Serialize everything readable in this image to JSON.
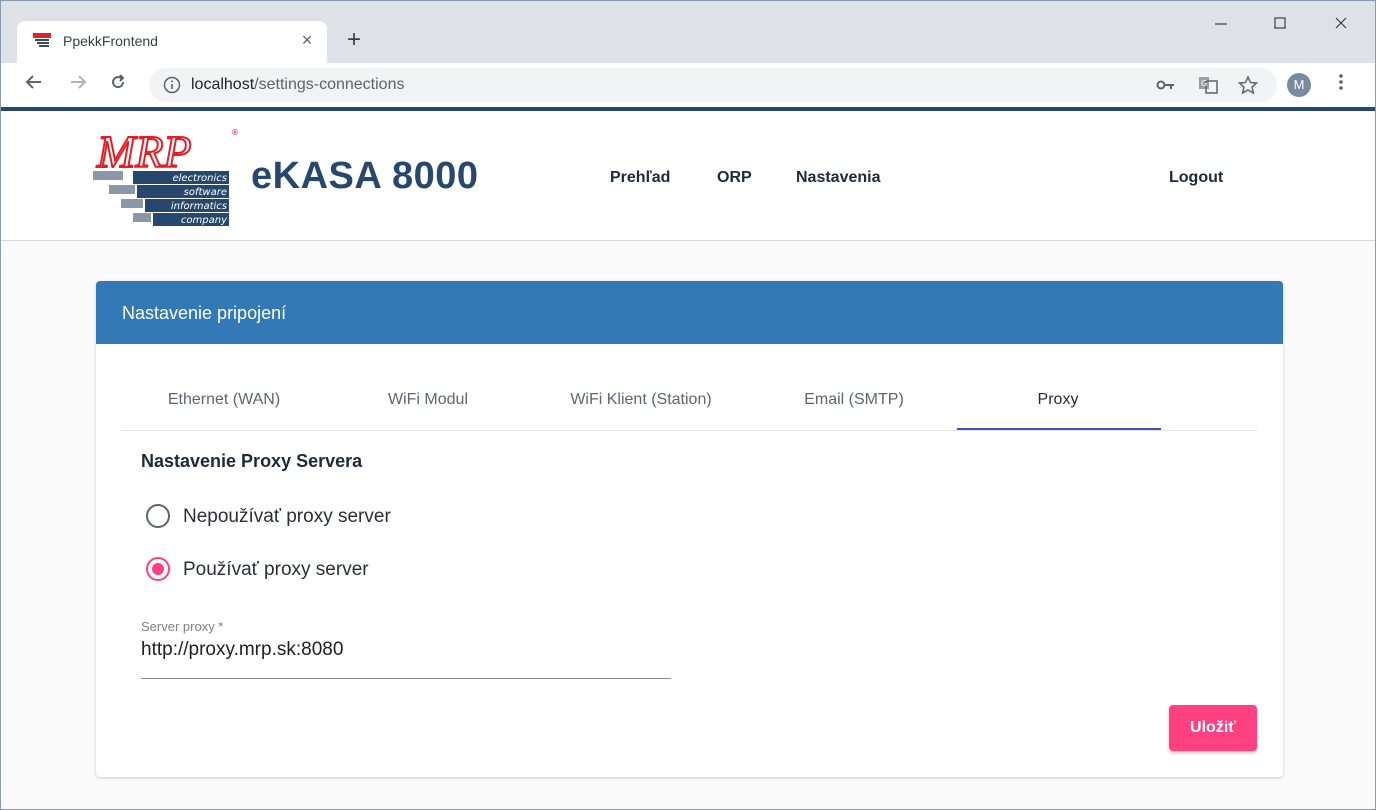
{
  "browser": {
    "tab_title": "PpekkFrontend",
    "new_tab_label": "+",
    "url_host": "localhost",
    "url_path": "/settings-connections",
    "avatar_letter": "M",
    "icons": {
      "back": "arrow-left",
      "forward": "arrow-right",
      "reload": "reload",
      "info": "info-circle",
      "key": "key",
      "translate": "translate",
      "bookmark": "star",
      "menu": "vertical-dots",
      "minimize": "minimize",
      "maximize": "maximize",
      "close": "close"
    }
  },
  "app": {
    "brand": "eKASA 8000",
    "logo": {
      "mark": "MRP",
      "lines": [
        "electronics",
        "software",
        "informatics",
        "company"
      ]
    },
    "nav": [
      "Prehľad",
      "ORP",
      "Nastavenia"
    ],
    "logout": "Logout"
  },
  "card": {
    "title": "Nastavenie pripojení",
    "tabs": [
      {
        "label": "Ethernet (WAN)",
        "active": false
      },
      {
        "label": "WiFi Modul",
        "active": false
      },
      {
        "label": "WiFi Klient (Station)",
        "active": false
      },
      {
        "label": "Email (SMTP)",
        "active": false
      },
      {
        "label": "Proxy",
        "active": true
      }
    ],
    "section_title": "Nastavenie Proxy Servera",
    "radio_options": [
      {
        "label": "Nepoužívať proxy server",
        "checked": false
      },
      {
        "label": "Používať proxy server",
        "checked": true
      }
    ],
    "proxy_field": {
      "label": "Server proxy *",
      "value": "http://proxy.mrp.sk:8080"
    },
    "save_label": "Uložiť"
  },
  "colors": {
    "brand_blue": "#27486e",
    "card_header": "#3379b6",
    "accent_pink": "#ff4081",
    "tab_ink": "#3f51b5"
  }
}
